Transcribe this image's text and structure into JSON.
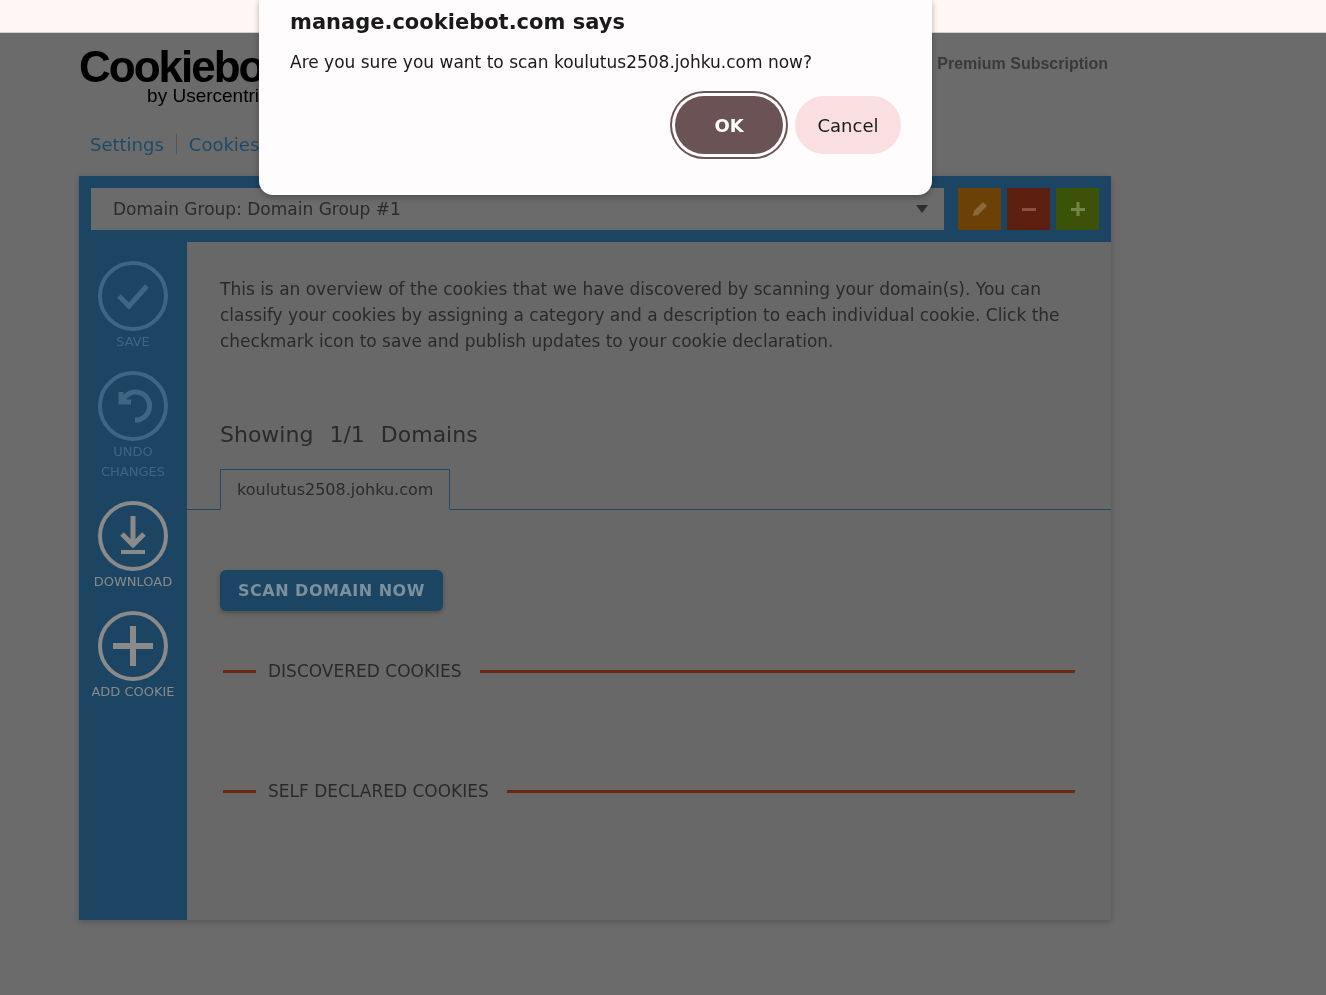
{
  "dialog": {
    "title": "manage.cookiebot.com says",
    "message": "Are you sure you want to scan koulutus2508.johku.com now?",
    "buttons": [
      {
        "label": "OK",
        "kind": "primary"
      },
      {
        "label": "Cancel",
        "kind": "secondary"
      }
    ]
  },
  "logo": {
    "name": "Cookiebo",
    "tagline": "by Usercentri"
  },
  "header_link": "Premium Subscription",
  "nav": [
    {
      "label": "Settings"
    },
    {
      "label": "Cookies"
    }
  ],
  "domain_group": {
    "value": "Domain Group: Domain Group #1"
  },
  "group_actions": [
    {
      "kind": "edit",
      "color": "#6b4107"
    },
    {
      "kind": "remove",
      "color": "#5c1f10"
    },
    {
      "kind": "add",
      "color": "#3d5209"
    }
  ],
  "sidebar": [
    {
      "kind": "save",
      "label": "SAVE",
      "disabled": true
    },
    {
      "kind": "undo",
      "label": "UNDO CHANGES",
      "disabled": true
    },
    {
      "kind": "download",
      "label": "DOWNLOAD",
      "disabled": false
    },
    {
      "kind": "add",
      "label": "ADD COOKIE",
      "disabled": false
    }
  ],
  "intro": "This is an overview of the cookies that we have discovered by scanning your domain(s). You can classify your cookies by assigning a category and a description to each individual cookie. Click the checkmark icon to save and publish updates to your cookie declaration.",
  "showing": {
    "label": "Showing",
    "count": "1/1",
    "unit": "Domains"
  },
  "domain_tabs": [
    {
      "label": "koulutus2508.johku.com",
      "selected": true
    }
  ],
  "scan_button": "SCAN DOMAIN NOW",
  "sections": [
    "DISCOVERED COOKIES",
    "SELF DECLARED COOKIES"
  ]
}
